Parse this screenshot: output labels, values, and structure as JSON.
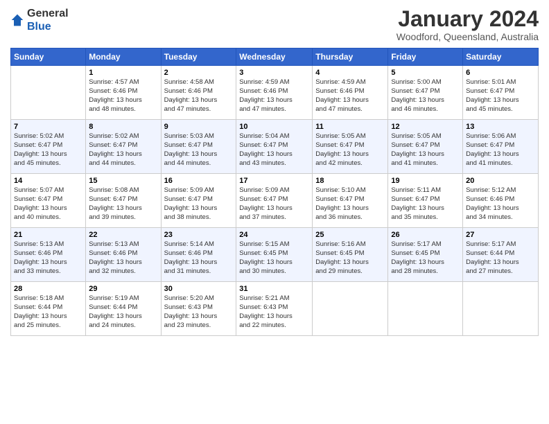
{
  "header": {
    "logo_line1": "General",
    "logo_line2": "Blue",
    "month_title": "January 2024",
    "location": "Woodford, Queensland, Australia"
  },
  "columns": [
    "Sunday",
    "Monday",
    "Tuesday",
    "Wednesday",
    "Thursday",
    "Friday",
    "Saturday"
  ],
  "weeks": [
    [
      {
        "day": "",
        "info": ""
      },
      {
        "day": "1",
        "info": "Sunrise: 4:57 AM\nSunset: 6:46 PM\nDaylight: 13 hours\nand 48 minutes."
      },
      {
        "day": "2",
        "info": "Sunrise: 4:58 AM\nSunset: 6:46 PM\nDaylight: 13 hours\nand 47 minutes."
      },
      {
        "day": "3",
        "info": "Sunrise: 4:59 AM\nSunset: 6:46 PM\nDaylight: 13 hours\nand 47 minutes."
      },
      {
        "day": "4",
        "info": "Sunrise: 4:59 AM\nSunset: 6:46 PM\nDaylight: 13 hours\nand 47 minutes."
      },
      {
        "day": "5",
        "info": "Sunrise: 5:00 AM\nSunset: 6:47 PM\nDaylight: 13 hours\nand 46 minutes."
      },
      {
        "day": "6",
        "info": "Sunrise: 5:01 AM\nSunset: 6:47 PM\nDaylight: 13 hours\nand 45 minutes."
      }
    ],
    [
      {
        "day": "7",
        "info": "Sunrise: 5:02 AM\nSunset: 6:47 PM\nDaylight: 13 hours\nand 45 minutes."
      },
      {
        "day": "8",
        "info": "Sunrise: 5:02 AM\nSunset: 6:47 PM\nDaylight: 13 hours\nand 44 minutes."
      },
      {
        "day": "9",
        "info": "Sunrise: 5:03 AM\nSunset: 6:47 PM\nDaylight: 13 hours\nand 44 minutes."
      },
      {
        "day": "10",
        "info": "Sunrise: 5:04 AM\nSunset: 6:47 PM\nDaylight: 13 hours\nand 43 minutes."
      },
      {
        "day": "11",
        "info": "Sunrise: 5:05 AM\nSunset: 6:47 PM\nDaylight: 13 hours\nand 42 minutes."
      },
      {
        "day": "12",
        "info": "Sunrise: 5:05 AM\nSunset: 6:47 PM\nDaylight: 13 hours\nand 41 minutes."
      },
      {
        "day": "13",
        "info": "Sunrise: 5:06 AM\nSunset: 6:47 PM\nDaylight: 13 hours\nand 41 minutes."
      }
    ],
    [
      {
        "day": "14",
        "info": "Sunrise: 5:07 AM\nSunset: 6:47 PM\nDaylight: 13 hours\nand 40 minutes."
      },
      {
        "day": "15",
        "info": "Sunrise: 5:08 AM\nSunset: 6:47 PM\nDaylight: 13 hours\nand 39 minutes."
      },
      {
        "day": "16",
        "info": "Sunrise: 5:09 AM\nSunset: 6:47 PM\nDaylight: 13 hours\nand 38 minutes."
      },
      {
        "day": "17",
        "info": "Sunrise: 5:09 AM\nSunset: 6:47 PM\nDaylight: 13 hours\nand 37 minutes."
      },
      {
        "day": "18",
        "info": "Sunrise: 5:10 AM\nSunset: 6:47 PM\nDaylight: 13 hours\nand 36 minutes."
      },
      {
        "day": "19",
        "info": "Sunrise: 5:11 AM\nSunset: 6:47 PM\nDaylight: 13 hours\nand 35 minutes."
      },
      {
        "day": "20",
        "info": "Sunrise: 5:12 AM\nSunset: 6:46 PM\nDaylight: 13 hours\nand 34 minutes."
      }
    ],
    [
      {
        "day": "21",
        "info": "Sunrise: 5:13 AM\nSunset: 6:46 PM\nDaylight: 13 hours\nand 33 minutes."
      },
      {
        "day": "22",
        "info": "Sunrise: 5:13 AM\nSunset: 6:46 PM\nDaylight: 13 hours\nand 32 minutes."
      },
      {
        "day": "23",
        "info": "Sunrise: 5:14 AM\nSunset: 6:46 PM\nDaylight: 13 hours\nand 31 minutes."
      },
      {
        "day": "24",
        "info": "Sunrise: 5:15 AM\nSunset: 6:45 PM\nDaylight: 13 hours\nand 30 minutes."
      },
      {
        "day": "25",
        "info": "Sunrise: 5:16 AM\nSunset: 6:45 PM\nDaylight: 13 hours\nand 29 minutes."
      },
      {
        "day": "26",
        "info": "Sunrise: 5:17 AM\nSunset: 6:45 PM\nDaylight: 13 hours\nand 28 minutes."
      },
      {
        "day": "27",
        "info": "Sunrise: 5:17 AM\nSunset: 6:44 PM\nDaylight: 13 hours\nand 27 minutes."
      }
    ],
    [
      {
        "day": "28",
        "info": "Sunrise: 5:18 AM\nSunset: 6:44 PM\nDaylight: 13 hours\nand 25 minutes."
      },
      {
        "day": "29",
        "info": "Sunrise: 5:19 AM\nSunset: 6:44 PM\nDaylight: 13 hours\nand 24 minutes."
      },
      {
        "day": "30",
        "info": "Sunrise: 5:20 AM\nSunset: 6:43 PM\nDaylight: 13 hours\nand 23 minutes."
      },
      {
        "day": "31",
        "info": "Sunrise: 5:21 AM\nSunset: 6:43 PM\nDaylight: 13 hours\nand 22 minutes."
      },
      {
        "day": "",
        "info": ""
      },
      {
        "day": "",
        "info": ""
      },
      {
        "day": "",
        "info": ""
      }
    ]
  ]
}
